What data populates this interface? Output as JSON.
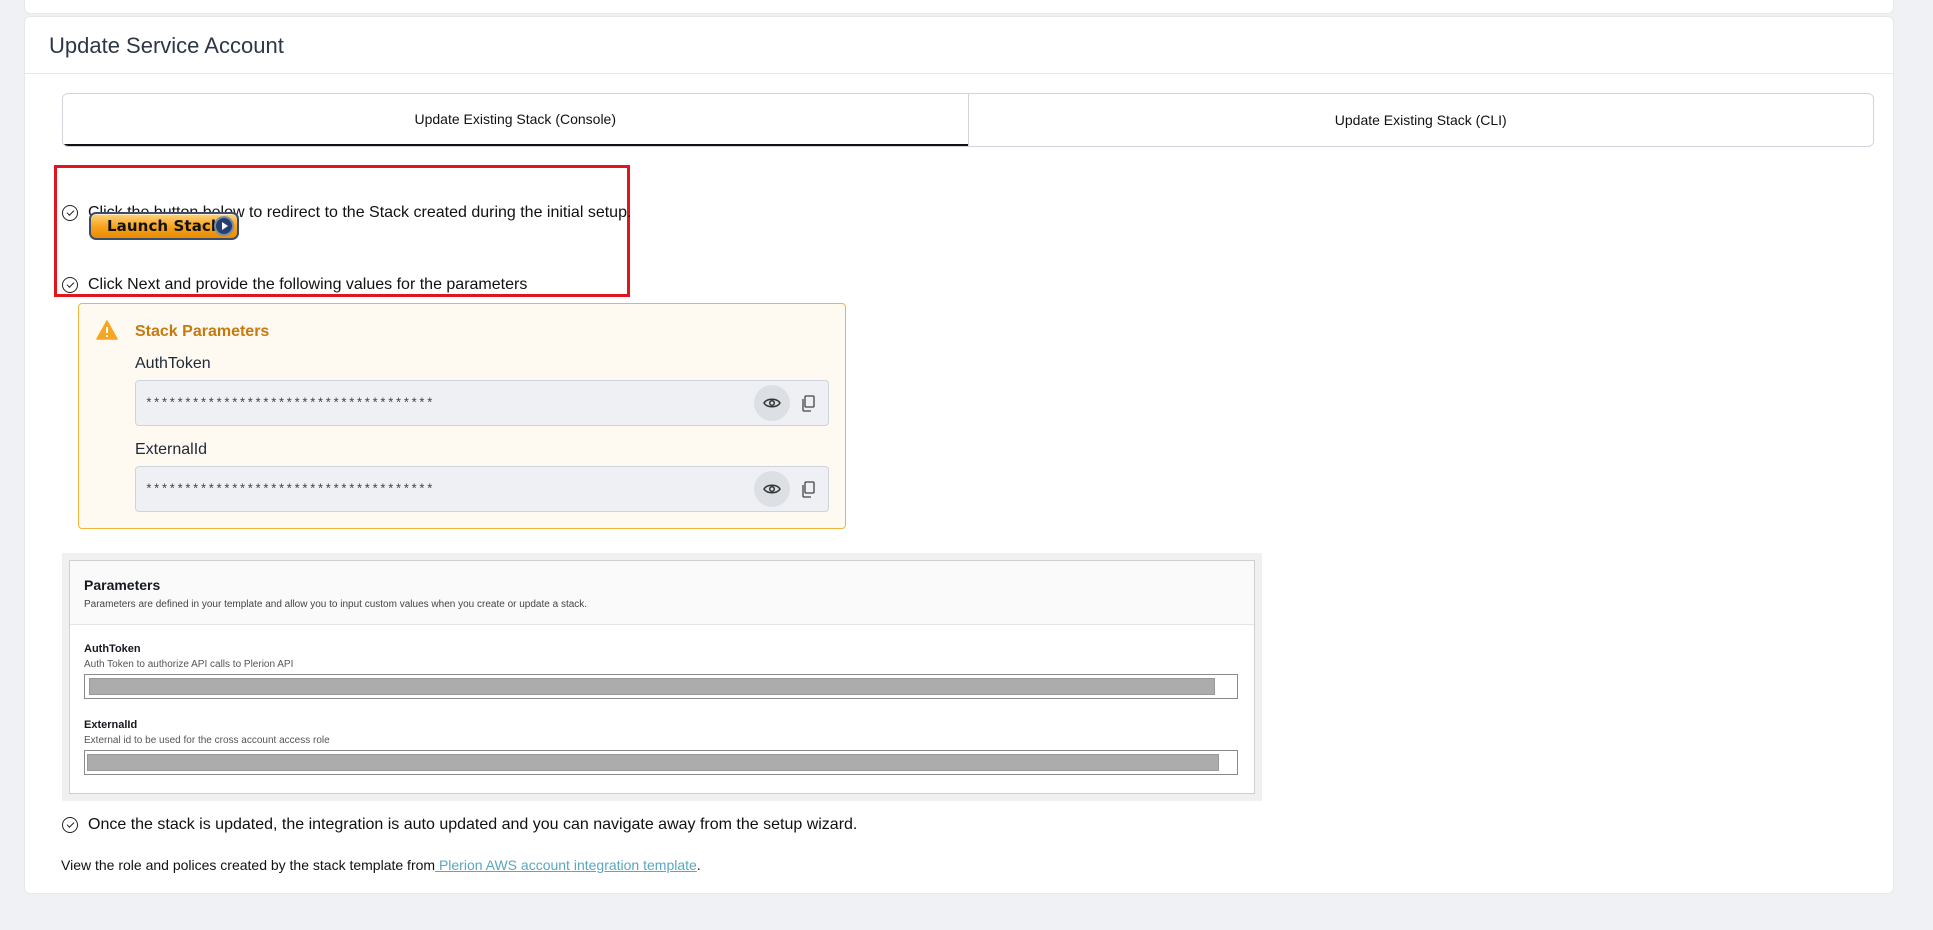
{
  "card": {
    "title": "Update Service Account"
  },
  "tabs": [
    {
      "label": "Update Existing Stack (Console)",
      "active": true
    },
    {
      "label": "Update Existing Stack (CLI)",
      "active": false
    }
  ],
  "steps": {
    "step1": "Click the button below to redirect to the Stack created during the initial setup.",
    "launch_button": "Launch Stack",
    "step2": "Click Next and provide the following values for the parameters",
    "step3": "Once the stack is updated, the integration is auto updated and you can navigate away from the setup wizard."
  },
  "stack_parameters": {
    "title": "Stack Parameters",
    "fields": [
      {
        "label": "AuthToken",
        "value": "*************************************"
      },
      {
        "label": "ExternalId",
        "value": "*************************************"
      }
    ]
  },
  "params_screenshot": {
    "title": "Parameters",
    "description": "Parameters are defined in your template and allow you to input custom values when you create or update a stack.",
    "fields": [
      {
        "label": "AuthToken",
        "description": "Auth Token to authorize API calls to Plerion API"
      },
      {
        "label": "ExternalId",
        "description": "External id to be used for the cross account access role"
      }
    ]
  },
  "footer": {
    "text": "View the role and polices created by the stack template from",
    "link": " Plerion AWS account integration template",
    "suffix": "."
  },
  "colors": {
    "accent_red": "#e3141b",
    "warning": "#c67a0e",
    "link": "#5aa7c0"
  }
}
